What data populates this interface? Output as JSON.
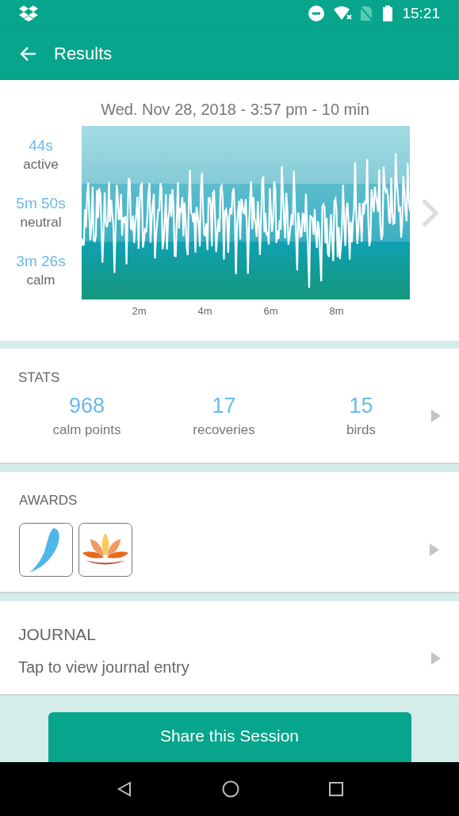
{
  "status_bar": {
    "time": "15:21"
  },
  "app_bar": {
    "title": "Results"
  },
  "session": {
    "date": "Wed. Nov 28, 2018 - 3:57 pm - 10 min",
    "zones": [
      {
        "kind": "active",
        "duration": "44s",
        "label": "active"
      },
      {
        "kind": "neutral",
        "duration": "5m 50s",
        "label": "neutral"
      },
      {
        "kind": "calm",
        "duration": "3m 26s",
        "label": "calm"
      }
    ],
    "x_ticks": [
      "2m",
      "4m",
      "6m",
      "8m"
    ]
  },
  "stats": {
    "title": "STATS",
    "items": [
      {
        "value": "968",
        "label": "calm points"
      },
      {
        "value": "17",
        "label": "recoveries"
      },
      {
        "value": "15",
        "label": "birds"
      }
    ]
  },
  "awards": {
    "title": "AWARDS",
    "items": [
      {
        "kind": "feather"
      },
      {
        "kind": "lotus"
      }
    ]
  },
  "journal": {
    "title": "JOURNAL",
    "text": "Tap to view journal entry"
  },
  "share_button": "Share this Session"
}
